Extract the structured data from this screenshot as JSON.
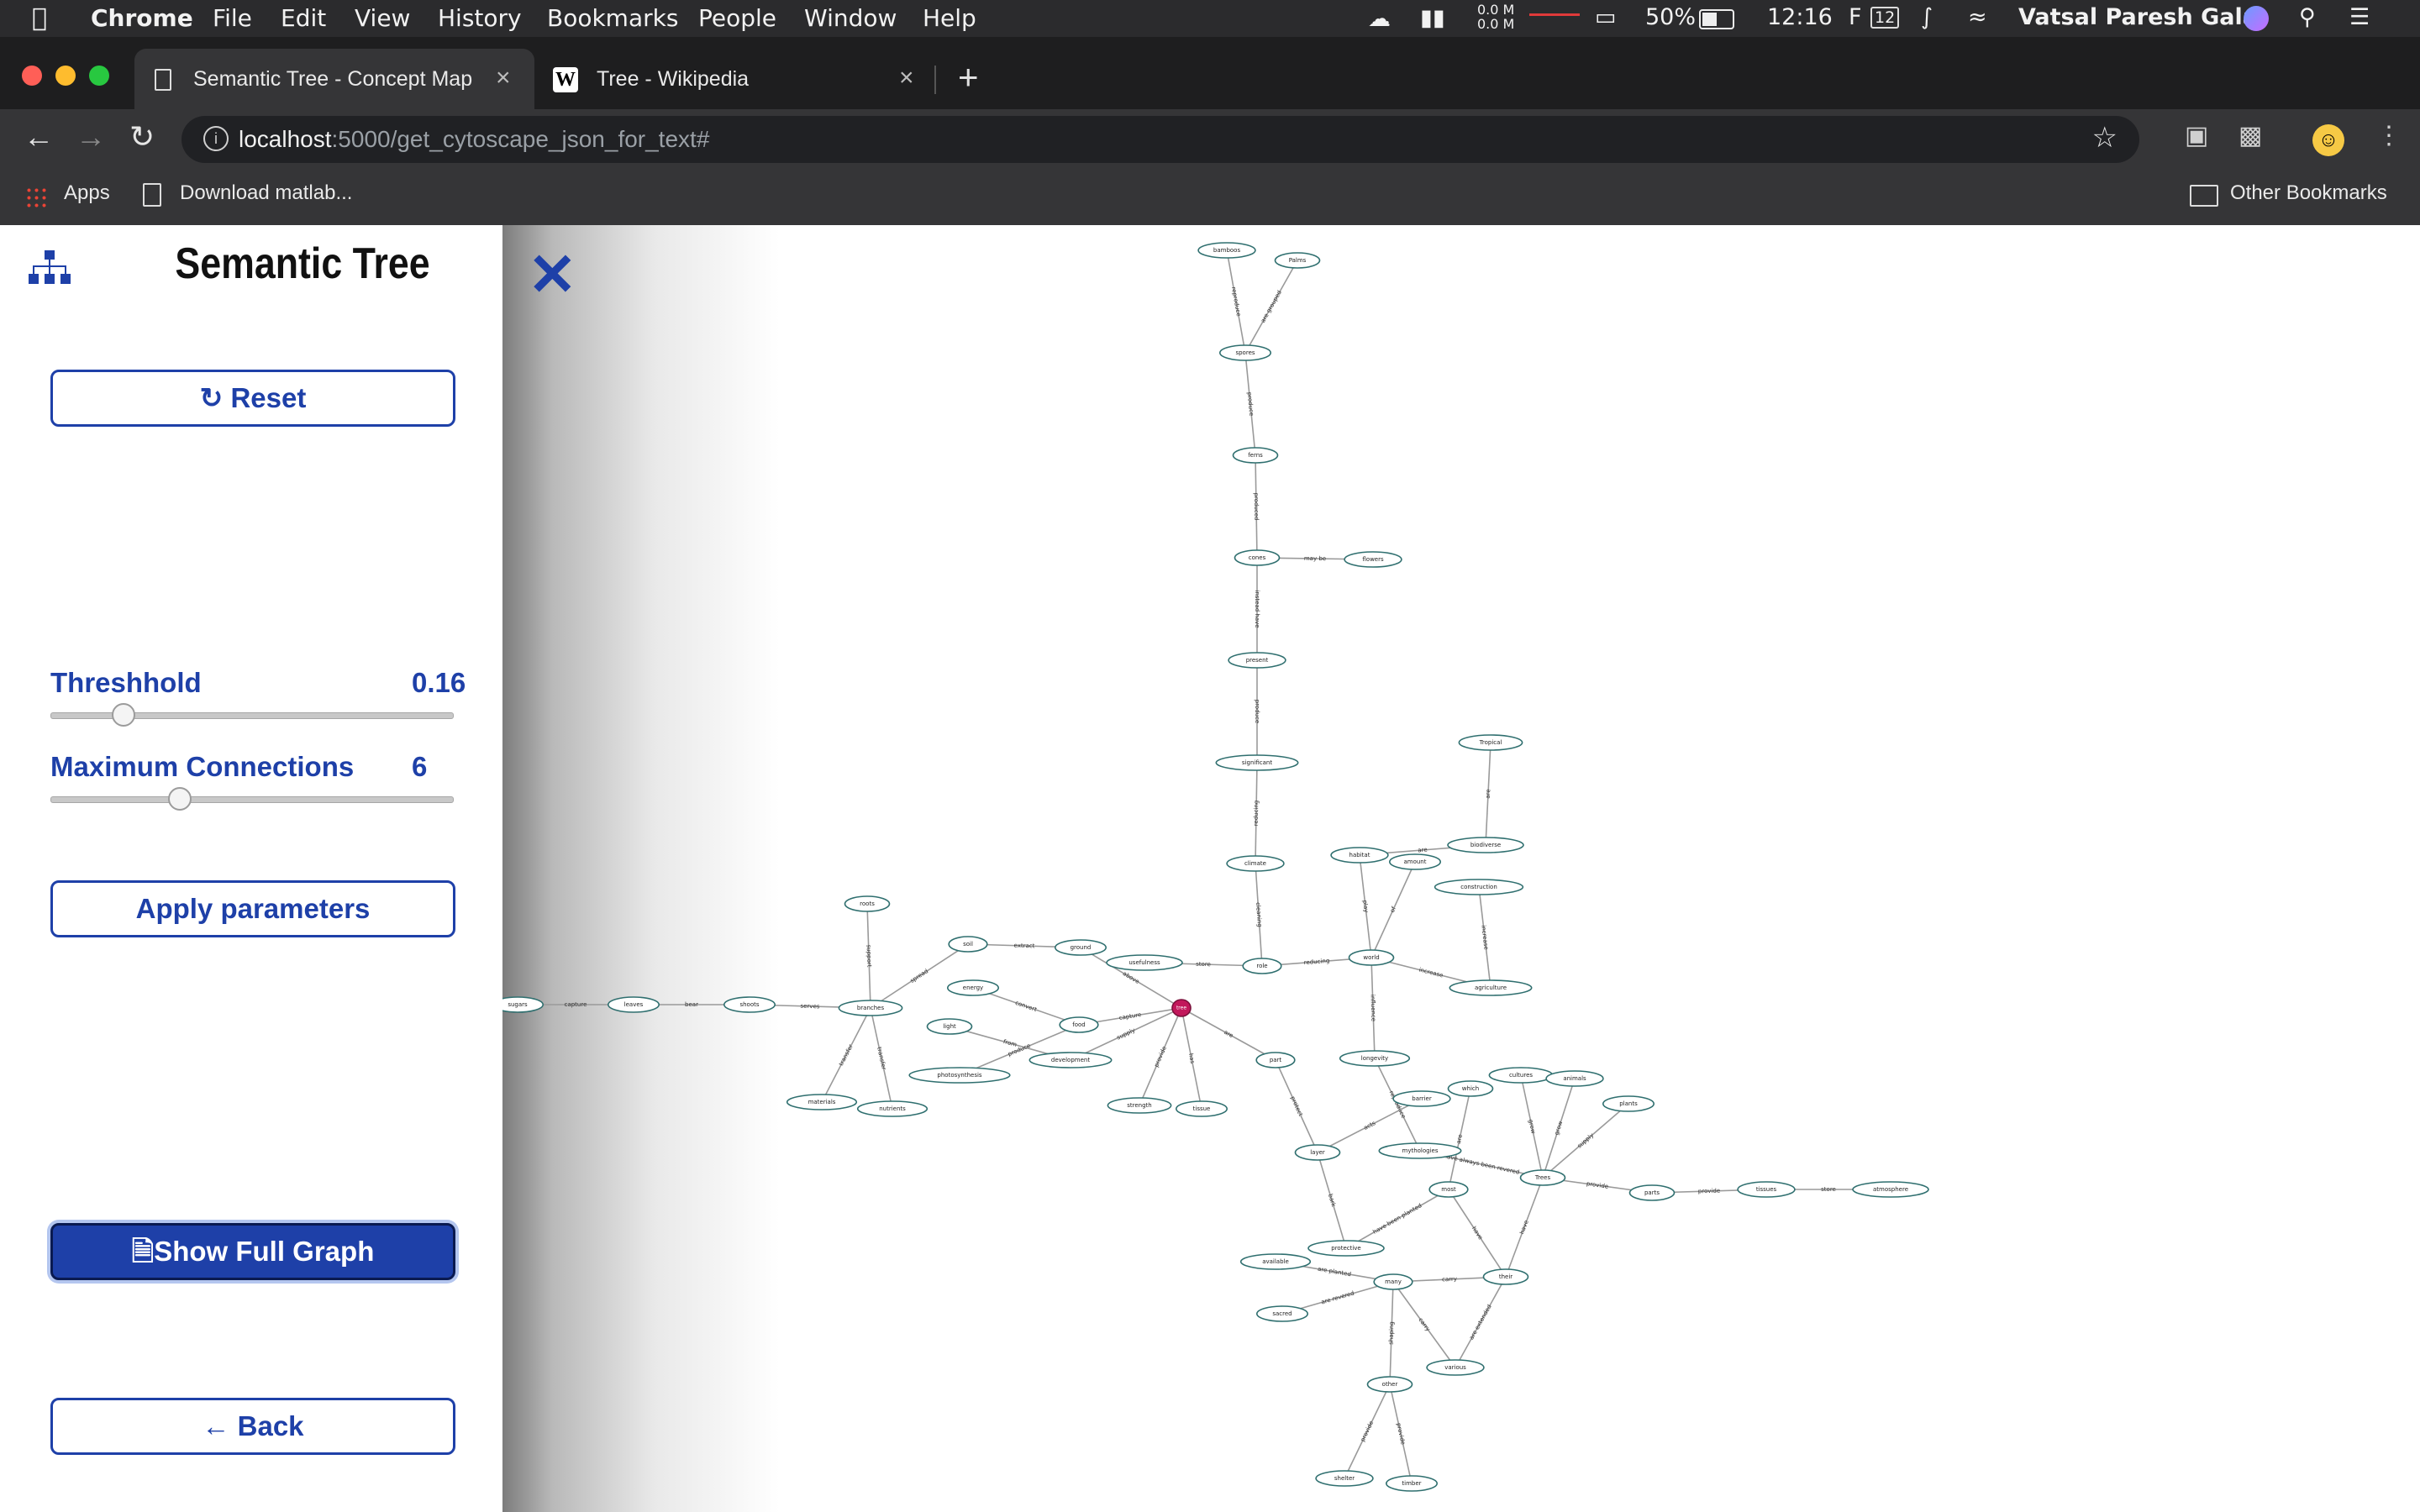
{
  "menubar": {
    "app": "Chrome",
    "items": [
      "File",
      "Edit",
      "View",
      "History",
      "Bookmarks",
      "People",
      "Window",
      "Help"
    ],
    "net_up": "0.0 M",
    "net_down": "0.0 M",
    "battery": "50%",
    "time": "12:16",
    "f_label": "F",
    "f_num": "12",
    "user": "Vatsal Paresh Gala"
  },
  "tabs": [
    {
      "title": "Semantic Tree - Concept Map",
      "icon": "page-icon"
    },
    {
      "title": "Tree - Wikipedia",
      "icon": "wikipedia-icon"
    }
  ],
  "address": {
    "host": "localhost",
    "rest": ":5000/get_cytoscape_json_for_text#"
  },
  "bookmarks": {
    "apps": "Apps",
    "item1": "Download matlab...",
    "other": "Other Bookmarks"
  },
  "sidebar": {
    "title": "Semantic Tree",
    "reset_label": "Reset",
    "threshold_label": "Threshhold",
    "threshold_value": "0.16",
    "threshold_fraction": 0.18,
    "maxconn_label": "Maximum Connections",
    "maxconn_value": "6",
    "maxconn_fraction": 0.32,
    "apply_label": "Apply parameters",
    "fullgraph_label": "Show Full Graph",
    "back_label": "← Back"
  },
  "colors": {
    "accent": "#1e40a8",
    "node_fill": "#ffffff",
    "node_stroke": "#2f6f6f",
    "highlight_node": "#c2185b"
  },
  "graph": {
    "nodes": [
      {
        "id": "bamboos",
        "label": "bamboos"
      },
      {
        "id": "palms",
        "label": "Palms"
      },
      {
        "id": "spores",
        "label": "spores"
      },
      {
        "id": "ferns",
        "label": "ferns"
      },
      {
        "id": "cones",
        "label": "cones"
      },
      {
        "id": "flowers",
        "label": "flowers"
      },
      {
        "id": "present",
        "label": "present"
      },
      {
        "id": "significant",
        "label": "significant"
      },
      {
        "id": "climate",
        "label": "climate"
      },
      {
        "id": "tropical",
        "label": "Tropical"
      },
      {
        "id": "biodiverse",
        "label": "biodiverse"
      },
      {
        "id": "habitat",
        "label": "habitat"
      },
      {
        "id": "amount",
        "label": "amount"
      },
      {
        "id": "construction",
        "label": "construction"
      },
      {
        "id": "roots",
        "label": "roots"
      },
      {
        "id": "soil",
        "label": "soil"
      },
      {
        "id": "ground",
        "label": "ground"
      },
      {
        "id": "usefulness",
        "label": "usefulness"
      },
      {
        "id": "role",
        "label": "role"
      },
      {
        "id": "world",
        "label": "world"
      },
      {
        "id": "agriculture",
        "label": "agriculture"
      },
      {
        "id": "sugars",
        "label": "sugars"
      },
      {
        "id": "leaves",
        "label": "leaves"
      },
      {
        "id": "shoots",
        "label": "shoots"
      },
      {
        "id": "branches",
        "label": "branches"
      },
      {
        "id": "energy",
        "label": "energy"
      },
      {
        "id": "light",
        "label": "light"
      },
      {
        "id": "food",
        "label": "food"
      },
      {
        "id": "tree",
        "label": "tree"
      },
      {
        "id": "development",
        "label": "development"
      },
      {
        "id": "photosynthesis",
        "label": "photosynthesis"
      },
      {
        "id": "part",
        "label": "part"
      },
      {
        "id": "longevity",
        "label": "longevity"
      },
      {
        "id": "materials",
        "label": "materials"
      },
      {
        "id": "nutrients",
        "label": "nutrients"
      },
      {
        "id": "strength",
        "label": "strength"
      },
      {
        "id": "tissue",
        "label": "tissue"
      },
      {
        "id": "barrier",
        "label": "barrier"
      },
      {
        "id": "which",
        "label": "which"
      },
      {
        "id": "cultures",
        "label": "cultures"
      },
      {
        "id": "animals",
        "label": "animals"
      },
      {
        "id": "plants",
        "label": "plants"
      },
      {
        "id": "layer",
        "label": "layer"
      },
      {
        "id": "mythologies",
        "label": "mythologies"
      },
      {
        "id": "trees",
        "label": "Trees"
      },
      {
        "id": "parts",
        "label": "parts"
      },
      {
        "id": "tissues",
        "label": "tissues"
      },
      {
        "id": "atmosphere",
        "label": "atmosphere"
      },
      {
        "id": "most",
        "label": "most"
      },
      {
        "id": "protective",
        "label": "protective"
      },
      {
        "id": "available",
        "label": "available"
      },
      {
        "id": "many",
        "label": "many"
      },
      {
        "id": "their",
        "label": "their"
      },
      {
        "id": "sacred",
        "label": "sacred"
      },
      {
        "id": "various",
        "label": "various"
      },
      {
        "id": "other",
        "label": "other"
      },
      {
        "id": "shelter",
        "label": "shelter"
      },
      {
        "id": "timber",
        "label": "timber"
      }
    ],
    "edges": [
      {
        "source": "bamboos",
        "target": "spores",
        "label": "reproduce"
      },
      {
        "source": "palms",
        "target": "spores",
        "label": "are grouped"
      },
      {
        "source": "spores",
        "target": "ferns",
        "label": "produce"
      },
      {
        "source": "ferns",
        "target": "cones",
        "label": "produced"
      },
      {
        "source": "cones",
        "target": "flowers",
        "label": "may be"
      },
      {
        "source": "cones",
        "target": "present",
        "label": "instead have"
      },
      {
        "source": "present",
        "target": "significant",
        "label": "produce"
      },
      {
        "source": "significant",
        "target": "climate",
        "label": "reducing"
      },
      {
        "source": "climate",
        "target": "role",
        "label": "cleaning"
      },
      {
        "source": "tropical",
        "target": "biodiverse",
        "label": "are"
      },
      {
        "source": "biodiverse",
        "target": "habitat",
        "label": "are"
      },
      {
        "source": "habitat",
        "target": "world",
        "label": "play"
      },
      {
        "source": "amount",
        "target": "world",
        "label": "of"
      },
      {
        "source": "construction",
        "target": "agriculture",
        "label": "increase"
      },
      {
        "source": "world",
        "target": "agriculture",
        "label": "increase"
      },
      {
        "source": "role",
        "target": "world",
        "label": "reducing"
      },
      {
        "source": "usefulness",
        "target": "role",
        "label": "store"
      },
      {
        "source": "soil",
        "target": "ground",
        "label": "extract"
      },
      {
        "source": "ground",
        "target": "tree",
        "label": "above"
      },
      {
        "source": "roots",
        "target": "branches",
        "label": "support"
      },
      {
        "source": "soil",
        "target": "branches",
        "label": "spread"
      },
      {
        "source": "sugars",
        "target": "leaves",
        "label": "capture"
      },
      {
        "source": "leaves",
        "target": "shoots",
        "label": "bear"
      },
      {
        "source": "shoots",
        "target": "branches",
        "label": "serves"
      },
      {
        "source": "branches",
        "target": "materials",
        "label": "transfer"
      },
      {
        "source": "branches",
        "target": "nutrients",
        "label": "transfer"
      },
      {
        "source": "energy",
        "target": "food",
        "label": "convert"
      },
      {
        "source": "light",
        "target": "development",
        "label": "from"
      },
      {
        "source": "food",
        "target": "tree",
        "label": "capture"
      },
      {
        "source": "development",
        "target": "tree",
        "label": "supply"
      },
      {
        "source": "photosynthesis",
        "target": "food",
        "label": "produce"
      },
      {
        "source": "tree",
        "target": "strength",
        "label": "provide"
      },
      {
        "source": "tree",
        "target": "tissue",
        "label": "has"
      },
      {
        "source": "tree",
        "target": "part",
        "label": "are"
      },
      {
        "source": "world",
        "target": "longevity",
        "label": "influence"
      },
      {
        "source": "part",
        "target": "layer",
        "label": "protect"
      },
      {
        "source": "longevity",
        "target": "mythologies",
        "label": "reproduce"
      },
      {
        "source": "barrier",
        "target": "layer",
        "label": "acts"
      },
      {
        "source": "layer",
        "target": "protective",
        "label": "bark"
      },
      {
        "source": "which",
        "target": "most",
        "label": "are"
      },
      {
        "source": "cultures",
        "target": "trees",
        "label": "grow"
      },
      {
        "source": "animals",
        "target": "trees",
        "label": "grow"
      },
      {
        "source": "plants",
        "target": "trees",
        "label": "supply"
      },
      {
        "source": "mythologies",
        "target": "trees",
        "label": "have always been revered"
      },
      {
        "source": "trees",
        "target": "parts",
        "label": "provide"
      },
      {
        "source": "parts",
        "target": "tissues",
        "label": "provide"
      },
      {
        "source": "tissues",
        "target": "atmosphere",
        "label": "store"
      },
      {
        "source": "most",
        "target": "protective",
        "label": "have been planted"
      },
      {
        "source": "most",
        "target": "their",
        "label": "have"
      },
      {
        "source": "trees",
        "target": "their",
        "label": "have"
      },
      {
        "source": "available",
        "target": "many",
        "label": "are planted"
      },
      {
        "source": "many",
        "target": "their",
        "label": "carry"
      },
      {
        "source": "sacred",
        "target": "many",
        "label": "are revered"
      },
      {
        "source": "many",
        "target": "various",
        "label": "carry"
      },
      {
        "source": "their",
        "target": "various",
        "label": "are extended"
      },
      {
        "source": "many",
        "target": "other",
        "label": "shaping"
      },
      {
        "source": "other",
        "target": "shelter",
        "label": "provide"
      },
      {
        "source": "other",
        "target": "timber",
        "label": "provide"
      }
    ]
  }
}
